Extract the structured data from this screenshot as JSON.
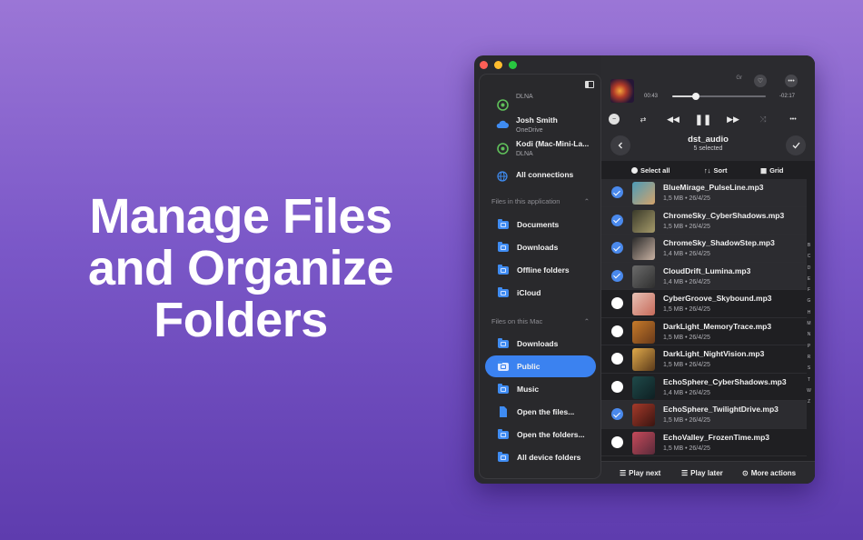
{
  "hero": {
    "line1": "Manage Files",
    "line2": "and Organize",
    "line3": "Folders"
  },
  "colors": {
    "accent": "#3b82f0",
    "check": "#4a89ec",
    "background_top": "#9b76d6",
    "background_bottom": "#5e3cae"
  },
  "window": {
    "traffic_lights": [
      "#fe5f57",
      "#febc2e",
      "#28c840"
    ]
  },
  "sidebar": {
    "connections": [
      {
        "name": "",
        "type": "DLNA",
        "icon": "dlna-icon"
      },
      {
        "name": "Josh Smith",
        "type": "OneDrive",
        "icon": "cloud-icon"
      },
      {
        "name": "Kodi (Mac-Mini-La...",
        "type": "DLNA",
        "icon": "dlna-icon"
      },
      {
        "name": "All connections",
        "type": "",
        "icon": "globe-icon"
      }
    ],
    "section_app": "Files in this application",
    "app_items": [
      "Documents",
      "Downloads",
      "Offline folders",
      "iCloud"
    ],
    "section_mac": "Files on this Mac",
    "mac_items": [
      "Downloads",
      "Public",
      "Music",
      "Open the files...",
      "Open the folders...",
      "All device folders"
    ],
    "active_item": "Public"
  },
  "player": {
    "elapsed": "00:43",
    "remaining": "-02:17",
    "progress": 0.24,
    "small_label": "Gr"
  },
  "header": {
    "title": "dst_audio",
    "subtitle": "5 selected"
  },
  "toolbar": {
    "select_all": "Select all",
    "sort": "Sort",
    "grid": "Grid"
  },
  "files": [
    {
      "name": "BlueMirage_PulseLine.mp3",
      "meta": "1,5 MB • 26/4/25",
      "selected": true,
      "color1": "#4b9bb8",
      "color2": "#d4a36a"
    },
    {
      "name": "ChromeSky_CyberShadows.mp3",
      "meta": "1,5 MB • 26/4/25",
      "selected": true,
      "color1": "#3a3a2a",
      "color2": "#a59a6a"
    },
    {
      "name": "ChromeSky_ShadowStep.mp3",
      "meta": "1,4 MB • 26/4/25",
      "selected": true,
      "color1": "#2a2a2a",
      "color2": "#c9b2a3"
    },
    {
      "name": "CloudDrift_Lumina.mp3",
      "meta": "1,4 MB • 26/4/25",
      "selected": true,
      "color1": "#6b6b6b",
      "color2": "#2f2f2f"
    },
    {
      "name": "CyberGroove_Skybound.mp3",
      "meta": "1,5 MB • 26/4/25",
      "selected": false,
      "color1": "#e8c1b5",
      "color2": "#c66a5a"
    },
    {
      "name": "DarkLight_MemoryTrace.mp3",
      "meta": "1,5 MB • 26/4/25",
      "selected": false,
      "color1": "#c67a2a",
      "color2": "#6a3a1a"
    },
    {
      "name": "DarkLight_NightVision.mp3",
      "meta": "1,5 MB • 26/4/25",
      "selected": false,
      "color1": "#e0a94a",
      "color2": "#5a3a1a"
    },
    {
      "name": "EchoSphere_CyberShadows.mp3",
      "meta": "1,4 MB • 26/4/25",
      "selected": false,
      "color1": "#1f4a4a",
      "color2": "#0e1f22"
    },
    {
      "name": "EchoSphere_TwilightDrive.mp3",
      "meta": "1,5 MB • 26/4/25",
      "selected": true,
      "color1": "#a53a2a",
      "color2": "#3a1410"
    },
    {
      "name": "EchoValley_FrozenTime.mp3",
      "meta": "1,5 MB • 26/4/25",
      "selected": false,
      "color1": "#c64a5a",
      "color2": "#5a2a3a"
    }
  ],
  "alphabet": [
    "B",
    "C",
    "D",
    "E",
    "F",
    "G",
    "H",
    "M",
    "N",
    "P",
    "R",
    "S",
    "T",
    "W",
    "Z"
  ],
  "bottom": {
    "play_next": "Play next",
    "play_later": "Play later",
    "more_actions": "More actions"
  }
}
